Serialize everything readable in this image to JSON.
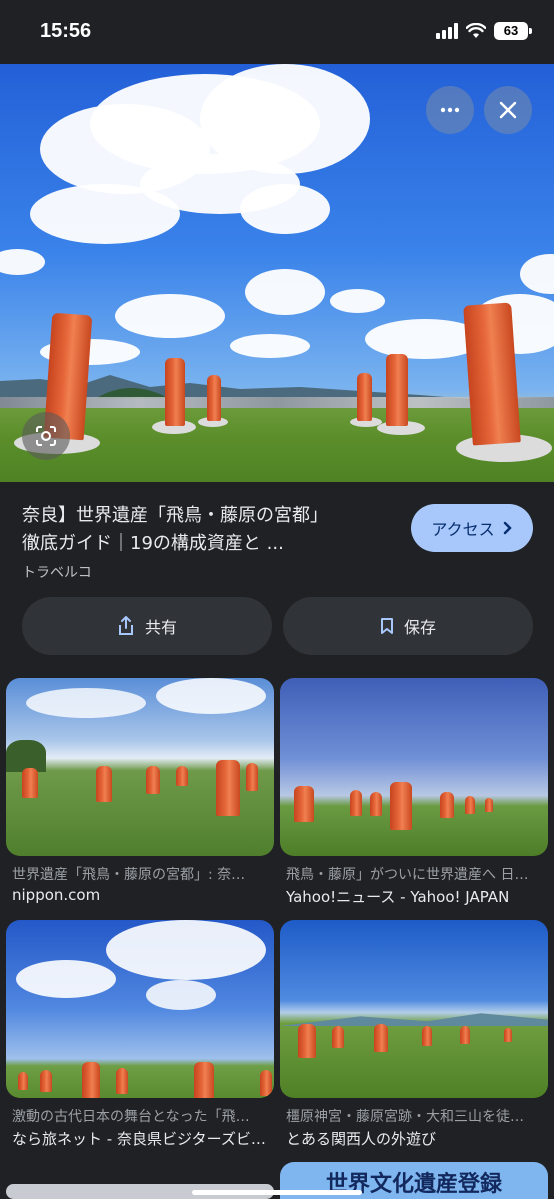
{
  "status": {
    "time": "15:56",
    "battery": "63"
  },
  "hero": {
    "more_icon": "more-horiz-icon",
    "close_icon": "close-icon",
    "lens_icon": "lens-icon"
  },
  "result": {
    "title_line1": "奈良】世界遺産「飛鳥・藤原の宮都」",
    "title_line2": "徹底ガイド｜19の構成資産と ...",
    "source": "トラベルコ",
    "access_label": "アクセス",
    "share_label": "共有",
    "save_label": "保存"
  },
  "related": [
    {
      "title": "世界遺産「飛鳥・藤原の宮都」: 奈…",
      "source": "nippon.com"
    },
    {
      "title": "飛鳥・藤原」がついに世界遺産へ 日…",
      "source": "Yahoo!ニュース - Yahoo! JAPAN"
    },
    {
      "title": "激動の古代日本の舞台となった「飛…",
      "source": "なら旅ネット - 奈良県ビジターズビ…"
    },
    {
      "title": "橿原神宮・藤原宮跡・大和三山を徒…",
      "source": "とある関西人の外遊び"
    },
    {
      "title": "",
      "source": "",
      "overlay_text": "世界文化遺産登録"
    }
  ],
  "colors": {
    "background": "#202124",
    "accent": "#a8c7fa",
    "pillar": "#e6673a"
  }
}
